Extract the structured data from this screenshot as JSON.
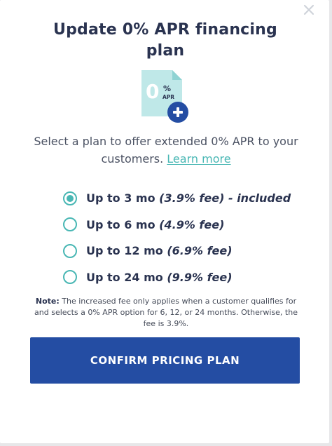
{
  "modal": {
    "title": "Update 0% APR financing plan",
    "icon": {
      "name": "apr-document-add-icon",
      "big_text": "0",
      "percent_text": "%",
      "apr_text": "APR"
    },
    "subtitle_text": "Select a plan to offer extended 0% APR to your customers.",
    "learn_more_label": "Learn more",
    "options": [
      {
        "label": "Up to 3 mo",
        "fee": "(3.9% fee) - included",
        "selected": true
      },
      {
        "label": "Up to 6 mo",
        "fee": "(4.9% fee)",
        "selected": false
      },
      {
        "label": "Up to 12 mo",
        "fee": "(6.9% fee)",
        "selected": false
      },
      {
        "label": "Up to 24 mo",
        "fee": "(9.9% fee)",
        "selected": false
      }
    ],
    "note_label": "Note:",
    "note_text": "The increased fee only applies when a customer qualifies for and selects a 0% APR option for 6, 12, or 24 months. Otherwise, the fee is 3.9%.",
    "confirm_label": "CONFIRM PRICING PLAN"
  },
  "colors": {
    "accent_teal": "#49b7b4",
    "primary_blue": "#244da3",
    "heading": "#2a3350",
    "icon_doc": "#bfe8e8",
    "icon_plus": "#244da3"
  }
}
